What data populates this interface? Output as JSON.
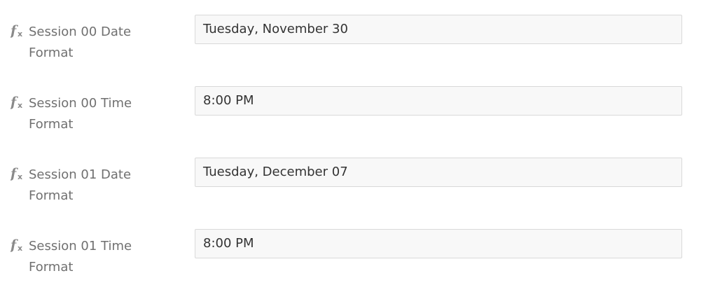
{
  "fields": [
    {
      "label_line1": "Session 00 Date",
      "label_line2": "Format",
      "value": "Tuesday, November 30"
    },
    {
      "label_line1": "Session 00 Time",
      "label_line2": "Format",
      "value": "8:00 PM"
    },
    {
      "label_line1": "Session 01 Date",
      "label_line2": "Format",
      "value": "Tuesday, December 07"
    },
    {
      "label_line1": "Session 01 Time",
      "label_line2": "Format",
      "value": "8:00 PM"
    }
  ],
  "icons": {
    "field_icon": "function-fx-icon"
  },
  "colors": {
    "label_text": "#707070",
    "value_text": "#333333",
    "input_background": "#f8f8f8",
    "input_border": "#d9d9d9"
  }
}
